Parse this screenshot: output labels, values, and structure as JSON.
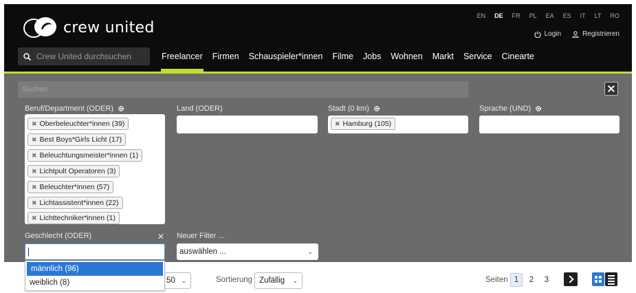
{
  "header": {
    "logo_text": "crew united",
    "languages": [
      "EN",
      "DE",
      "FR",
      "PL",
      "EA",
      "ES",
      "IT",
      "LT",
      "RO"
    ],
    "active_language": "DE",
    "login_label": "Login",
    "register_label": "Registrieren",
    "search_placeholder": "Crew United durchsuchen",
    "nav": [
      "Freelancer",
      "Firmen",
      "Schauspieler*innen",
      "Filme",
      "Jobs",
      "Wohnen",
      "Markt",
      "Service",
      "Cinearte"
    ],
    "active_nav": "Freelancer",
    "accent_color": "#bde02a"
  },
  "filters": {
    "search_placeholder": "Suchen",
    "department": {
      "label": "Beruf/Department (ODER)",
      "tags": [
        "Oberbeleuchter*innen (39)",
        "Best Boys*Girls Licht (17)",
        "Beleuchtungsmeister*innen (1)",
        "Lichtpult Operatoren (3)",
        "Beleuchter*innen (57)",
        "Lichtassistent*innen (22)",
        "Lichttechniker*innen (1)"
      ]
    },
    "country": {
      "label": "Land (ODER)"
    },
    "city": {
      "label": "Stadt (0 km)",
      "tags": [
        "Hamburg (105)"
      ]
    },
    "language": {
      "label": "Sprache (UND)"
    },
    "gender": {
      "label": "Geschlecht (ODER)",
      "options": [
        "männlich (96)",
        "weiblich (8)"
      ],
      "highlighted": "männlich (96)"
    },
    "new_filter": {
      "label": "Neuer Filter ...",
      "value": "auswählen ..."
    }
  },
  "toolbar": {
    "per_page": "50",
    "sort_label": "Sortierung",
    "sort_value": "Zufällig",
    "pages_label": "Seiten",
    "pages": [
      "1",
      "2",
      "3"
    ],
    "current_page": "1"
  }
}
